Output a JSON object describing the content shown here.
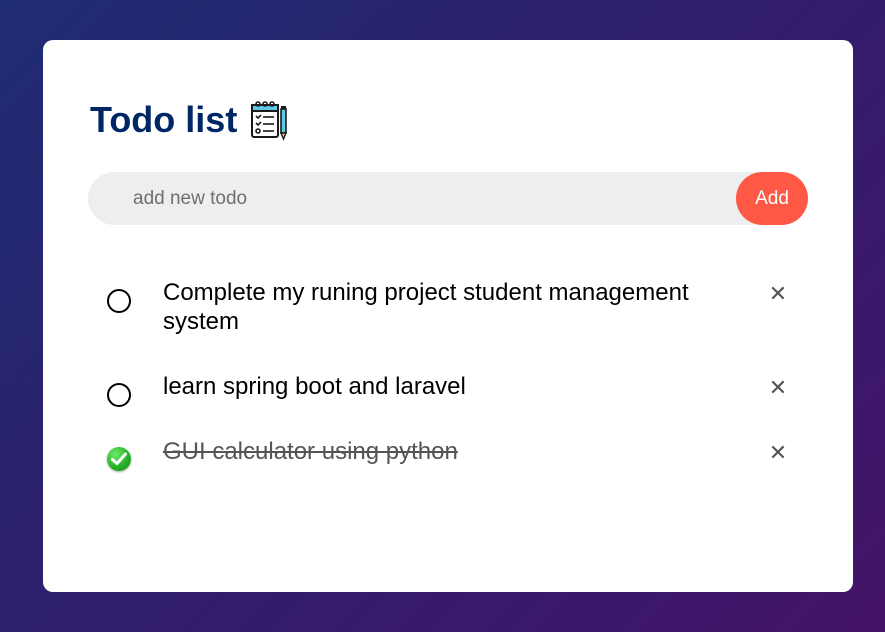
{
  "app": {
    "title": "Todo list"
  },
  "input": {
    "placeholder": "add new todo",
    "value": "",
    "add_label": "Add"
  },
  "todos": [
    {
      "text": "Complete my runing project student management system",
      "done": false
    },
    {
      "text": "learn spring boot and laravel",
      "done": false
    },
    {
      "text": "GUI calculator using python",
      "done": true
    }
  ],
  "icons": {
    "title_icon": "checklist-notepad-icon",
    "remove_icon": "close-icon",
    "unchecked_icon": "empty-circle-icon",
    "checked_icon": "green-check-circle-icon",
    "remove_glyph": "✕"
  },
  "colors": {
    "title": "#002765",
    "accent": "#ff5945",
    "input_bg": "#edeef0",
    "bg_gradient_start": "#1f2d74",
    "bg_gradient_end": "#441468"
  }
}
